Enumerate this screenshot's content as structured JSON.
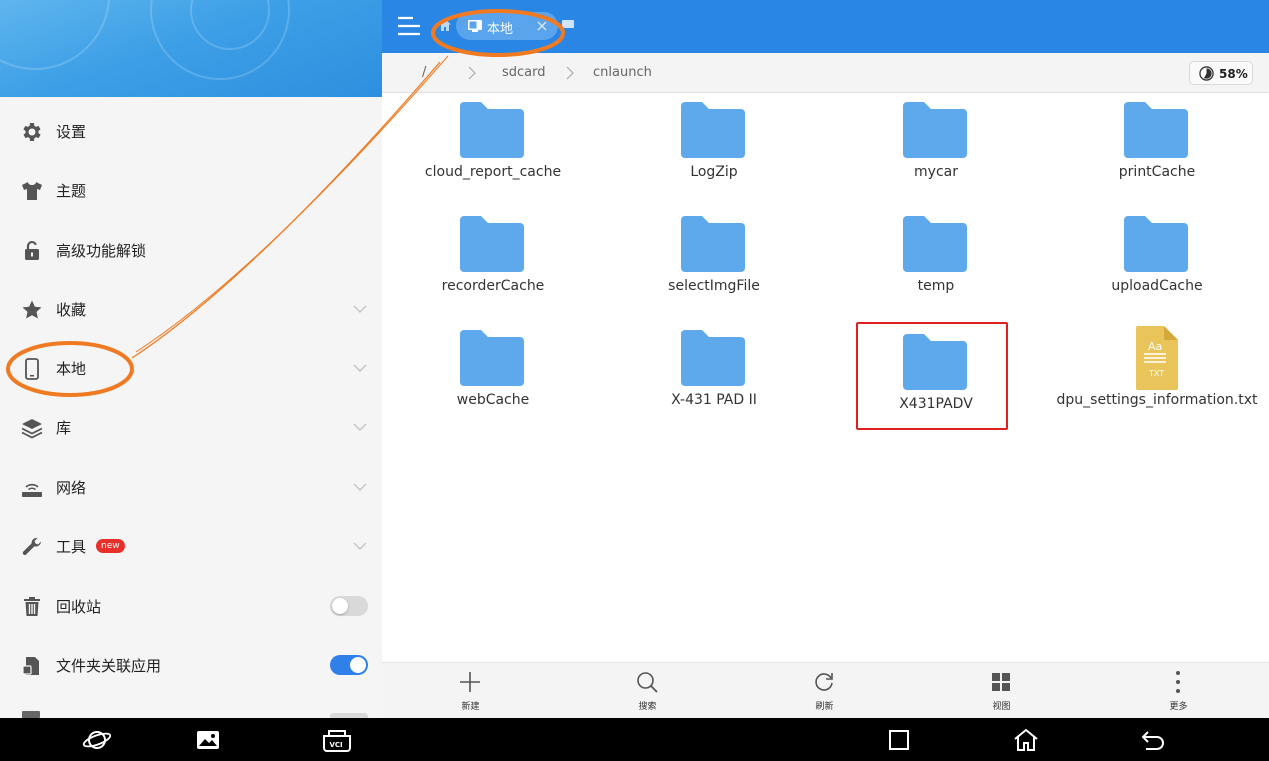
{
  "sidebar": {
    "items": [
      {
        "label": "设置"
      },
      {
        "label": "主题"
      },
      {
        "label": "高级功能解锁"
      },
      {
        "label": "收藏"
      },
      {
        "label": "本地"
      },
      {
        "label": "库"
      },
      {
        "label": "网络"
      },
      {
        "label": "工具",
        "badge": "new"
      },
      {
        "label": "回收站",
        "toggle": false
      },
      {
        "label": "文件夹关联应用",
        "toggle": true
      }
    ]
  },
  "tabs": {
    "active_label": "本地"
  },
  "breadcrumb": {
    "root": "/",
    "items": [
      "sdcard",
      "cnlaunch"
    ]
  },
  "storage": {
    "percent_label": "58%",
    "percent_used": 58
  },
  "files": [
    {
      "name": "cloud_report_cache",
      "type": "folder"
    },
    {
      "name": "LogZip",
      "type": "folder"
    },
    {
      "name": "mycar",
      "type": "folder"
    },
    {
      "name": "printCache",
      "type": "folder"
    },
    {
      "name": "recorderCache",
      "type": "folder"
    },
    {
      "name": "selectImgFile",
      "type": "folder"
    },
    {
      "name": "temp",
      "type": "folder"
    },
    {
      "name": "uploadCache",
      "type": "folder"
    },
    {
      "name": "webCache",
      "type": "folder"
    },
    {
      "name": "X-431 PAD II",
      "type": "folder"
    },
    {
      "name": "X431PADV",
      "type": "folder",
      "highlighted": true
    },
    {
      "name": "dpu_settings_information.txt",
      "type": "txt",
      "icon_text_top": "Aa",
      "icon_text_bottom": "TXT"
    }
  ],
  "toolbar": {
    "new_label": "新建",
    "search_label": "搜索",
    "refresh_label": "刷新",
    "view_label": "视图",
    "more_label": "更多"
  },
  "colors": {
    "topbar": "#2a86e4",
    "folder": "#5ea9ec",
    "highlight_box": "#e02020",
    "annotation": "#f07a22",
    "toggle_on": "#2f80e8"
  }
}
